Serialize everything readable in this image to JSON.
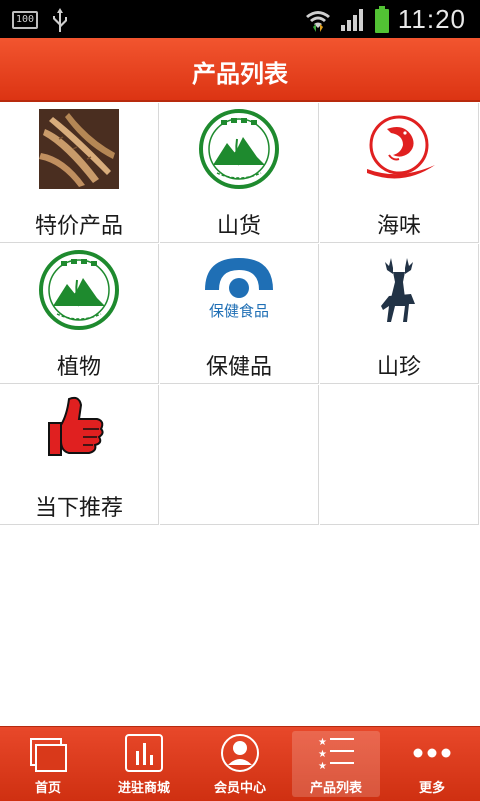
{
  "status_bar": {
    "battery_level": "100",
    "time": "11:20"
  },
  "header": {
    "title": "产品列表"
  },
  "categories": [
    {
      "label": "特价产品",
      "icon": "ginseng-photo"
    },
    {
      "label": "山货",
      "icon": "wild-health-seal-icon"
    },
    {
      "label": "海味",
      "icon": "shrimp-logo-icon"
    },
    {
      "label": "植物",
      "icon": "wild-health-seal-icon"
    },
    {
      "label": "保健品",
      "icon": "health-food-logo-icon"
    },
    {
      "label": "山珍",
      "icon": "deer-icon"
    },
    {
      "label": "当下推荐",
      "icon": "thumbs-up-icon"
    }
  ],
  "logo_text": {
    "health_food": "保健食品"
  },
  "bottom_nav": [
    {
      "label": "首页",
      "icon": "pages-icon"
    },
    {
      "label": "进驻商城",
      "icon": "bars-icon"
    },
    {
      "label": "会员中心",
      "icon": "user-icon"
    },
    {
      "label": "产品列表",
      "icon": "list-icon",
      "active": true
    },
    {
      "label": "更多",
      "icon": "more-icon"
    }
  ],
  "colors": {
    "primary": "#e03a18",
    "dark": "#b82a0d",
    "seal_green": "#1e8a2e",
    "logo_blue": "#1f6fb5"
  }
}
